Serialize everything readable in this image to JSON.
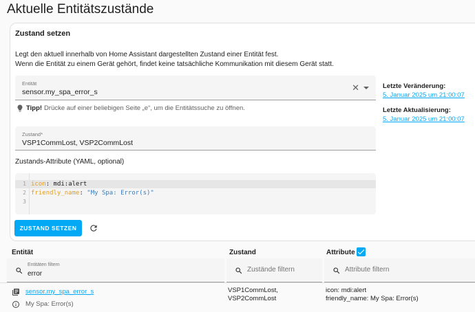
{
  "page": {
    "title": "Aktuelle Entitätszustände"
  },
  "card": {
    "title": "Zustand setzen",
    "desc_line1": "Legt den aktuell innerhalb von Home Assistant dargestellten Zustand einer Entität fest.",
    "desc_line2": "Wenn die Entität zu einem Gerät gehört, findet keine tatsächliche Kommunikation mit diesem Gerät statt.",
    "entity_label": "Entität",
    "entity_value": "sensor.my_spa_error_s",
    "tip_bold": "Tipp!",
    "tip_text": "Drücke auf einer beliebigen Seite „e“, um die Entitätssuche zu öffnen.",
    "state_label": "Zustand*",
    "state_value": "VSP1CommLost, VSP2CommLost",
    "attr_label": "Zustands-Attribute (YAML, optional)",
    "code": [
      {
        "n": "1",
        "key": "icon",
        "sep": ": ",
        "val": "mdi:alert",
        "val_type": "plain"
      },
      {
        "n": "2",
        "key": "friendly_name",
        "sep": ": ",
        "val": "\"My Spa: Error(s)\"",
        "val_type": "str"
      },
      {
        "n": "3",
        "key": "",
        "sep": "",
        "val": "",
        "val_type": "plain"
      }
    ],
    "set_button": "ZUSTAND SETZEN"
  },
  "meta": {
    "last_changed_label": "Letzte Veränderung:",
    "last_changed_value": "5. Januar 2025 um 21:00:07",
    "last_updated_label": "Letzte Aktualisierung:",
    "last_updated_value": "5. Januar 2025 um 21:00:07"
  },
  "table": {
    "col_entity": "Entität",
    "col_state": "Zustand",
    "col_attributes": "Attribute",
    "attributes_checked": true,
    "filter_entity_label": "Entitäten filtern",
    "filter_entity_value": "error",
    "filter_state_placeholder": "Zustände filtern",
    "filter_attr_placeholder": "Attribute filtern",
    "row": {
      "entity_id": "sensor.my_spa_error_s",
      "friendly": "My Spa: Error(s)",
      "state_line1": "VSP1CommLost,",
      "state_line2": "VSP2CommLost",
      "attr_line1": "icon: mdi:alert",
      "attr_line2": "friendly_name: My Spa: Error(s)"
    }
  },
  "colors": {
    "accent": "#03a9f4",
    "key": "#e69d1e",
    "string": "#3c7bb9"
  }
}
